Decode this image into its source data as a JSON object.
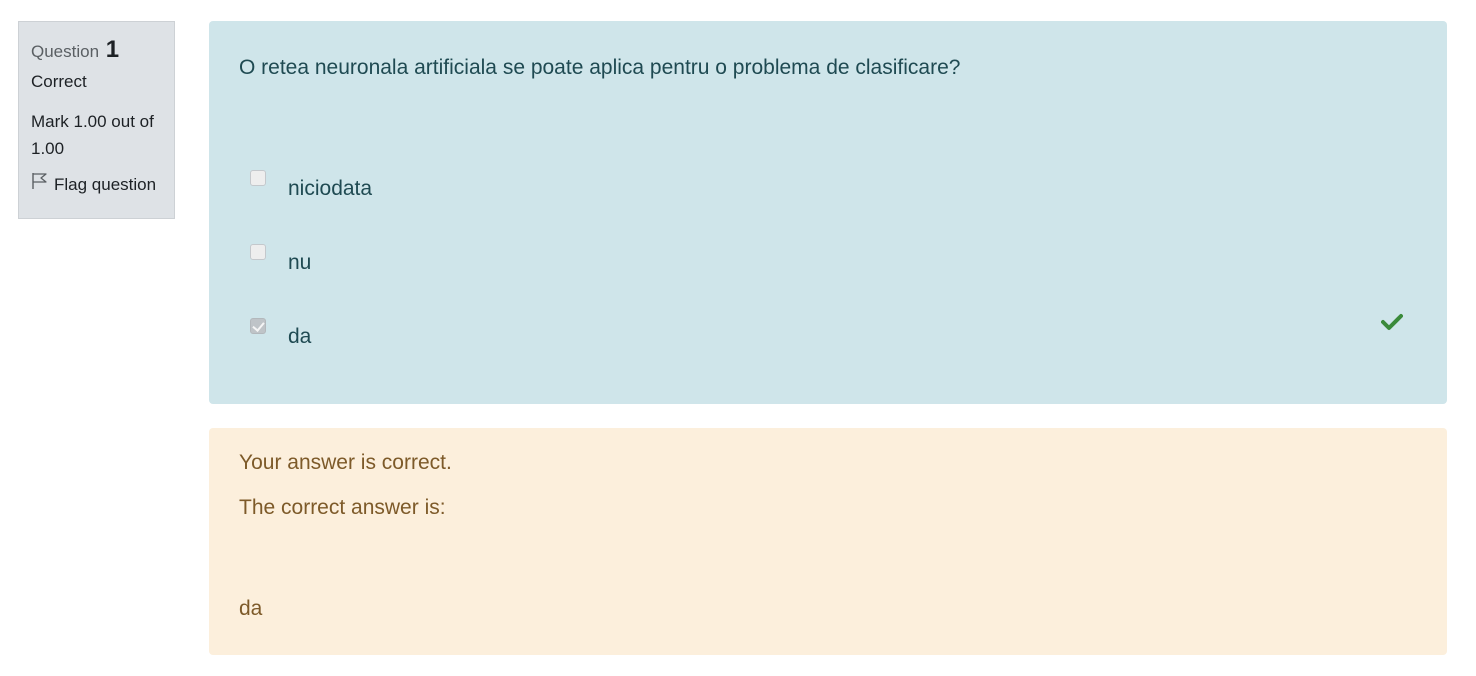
{
  "info": {
    "question_label": "Question",
    "question_number": "1",
    "state": "Correct",
    "grade": "Mark 1.00 out of 1.00",
    "flag_label": "Flag question"
  },
  "question": {
    "text": "O retea neuronala artificiala se poate aplica pentru o problema de clasificare?",
    "answers": [
      {
        "label": "niciodata",
        "checked": false
      },
      {
        "label": "nu",
        "checked": false
      },
      {
        "label": "da",
        "checked": true,
        "mark_icon": "checkmark-icon"
      }
    ]
  },
  "feedback": {
    "result": "Your answer is correct.",
    "correct_answer_label": "The correct answer is:",
    "correct_answer": "da"
  },
  "colors": {
    "info_bg": "#dee2e6",
    "question_bg": "#cfe5ea",
    "feedback_bg": "#fcefdc",
    "correct_green": "#3a8a3a"
  }
}
